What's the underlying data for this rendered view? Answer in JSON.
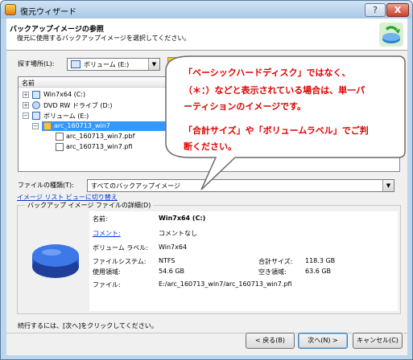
{
  "window": {
    "title": "復元ウィザード",
    "help_label": "?",
    "close_label": "X"
  },
  "header": {
    "title": "バックアップイメージの参照",
    "subtitle": "復元に使用するバックアップイメージを選択してください。"
  },
  "search": {
    "label": "探す場所(L):",
    "value": "ボリューム (E:)"
  },
  "tree": {
    "column_header": "名前",
    "nodes": [
      {
        "label": "Win7x64 (C:)",
        "expander": "+"
      },
      {
        "label": "DVD RW ドライブ (D:)",
        "expander": "+"
      },
      {
        "label": "ボリューム (E:)",
        "expander": "−"
      },
      {
        "label": "arc_160713_win7",
        "expander": "−"
      },
      {
        "label": "arc_160713_win7.pbf",
        "expander": ""
      },
      {
        "label": "arc_160713_win7.pfi",
        "expander": ""
      }
    ]
  },
  "file_type": {
    "label": "ファイルの種類(T):",
    "value": "すべてのバックアップイメージ"
  },
  "switch_link": "イメージ リスト ビューに切り替え",
  "details": {
    "group_title": "バックアップ イメージ ファイルの詳細(D)",
    "name_label": "名前:",
    "name_value": "Win7x64 (C:)",
    "comment_label": "コメント:",
    "comment_value": "コメントなし",
    "volume_label_label": "ボリューム ラベル:",
    "volume_label_value": "Win7x64",
    "fs_label": "ファイルシステム:",
    "fs_value": "NTFS",
    "total_size_label": "合計サイズ:",
    "total_size_value": "118.3 GB",
    "used_label": "使用領域:",
    "used_value": "54.6 GB",
    "free_label": "空き領域:",
    "free_value": "63.6 GB",
    "file_label": "ファイル:",
    "file_value": "E:/arc_160713_win7/arc_160713_win7.pfi"
  },
  "footer": {
    "hint": "続行するには、[次へ]をクリックしてください。",
    "back_label": "< 戻る(B)",
    "next_label": "次へ(N) >",
    "cancel_label": "キャンセル(C)"
  },
  "callout": {
    "line1": "「ベーシックハードディスク」ではなく、",
    "line2": "（＊：）などと表示されている場合は、単一パ",
    "line3": "ーティションのイメージです。",
    "line4": "「合計サイズ」や「ボリュームラベル」でご判",
    "line5": "断ください。",
    "text_color": "#e00000"
  }
}
